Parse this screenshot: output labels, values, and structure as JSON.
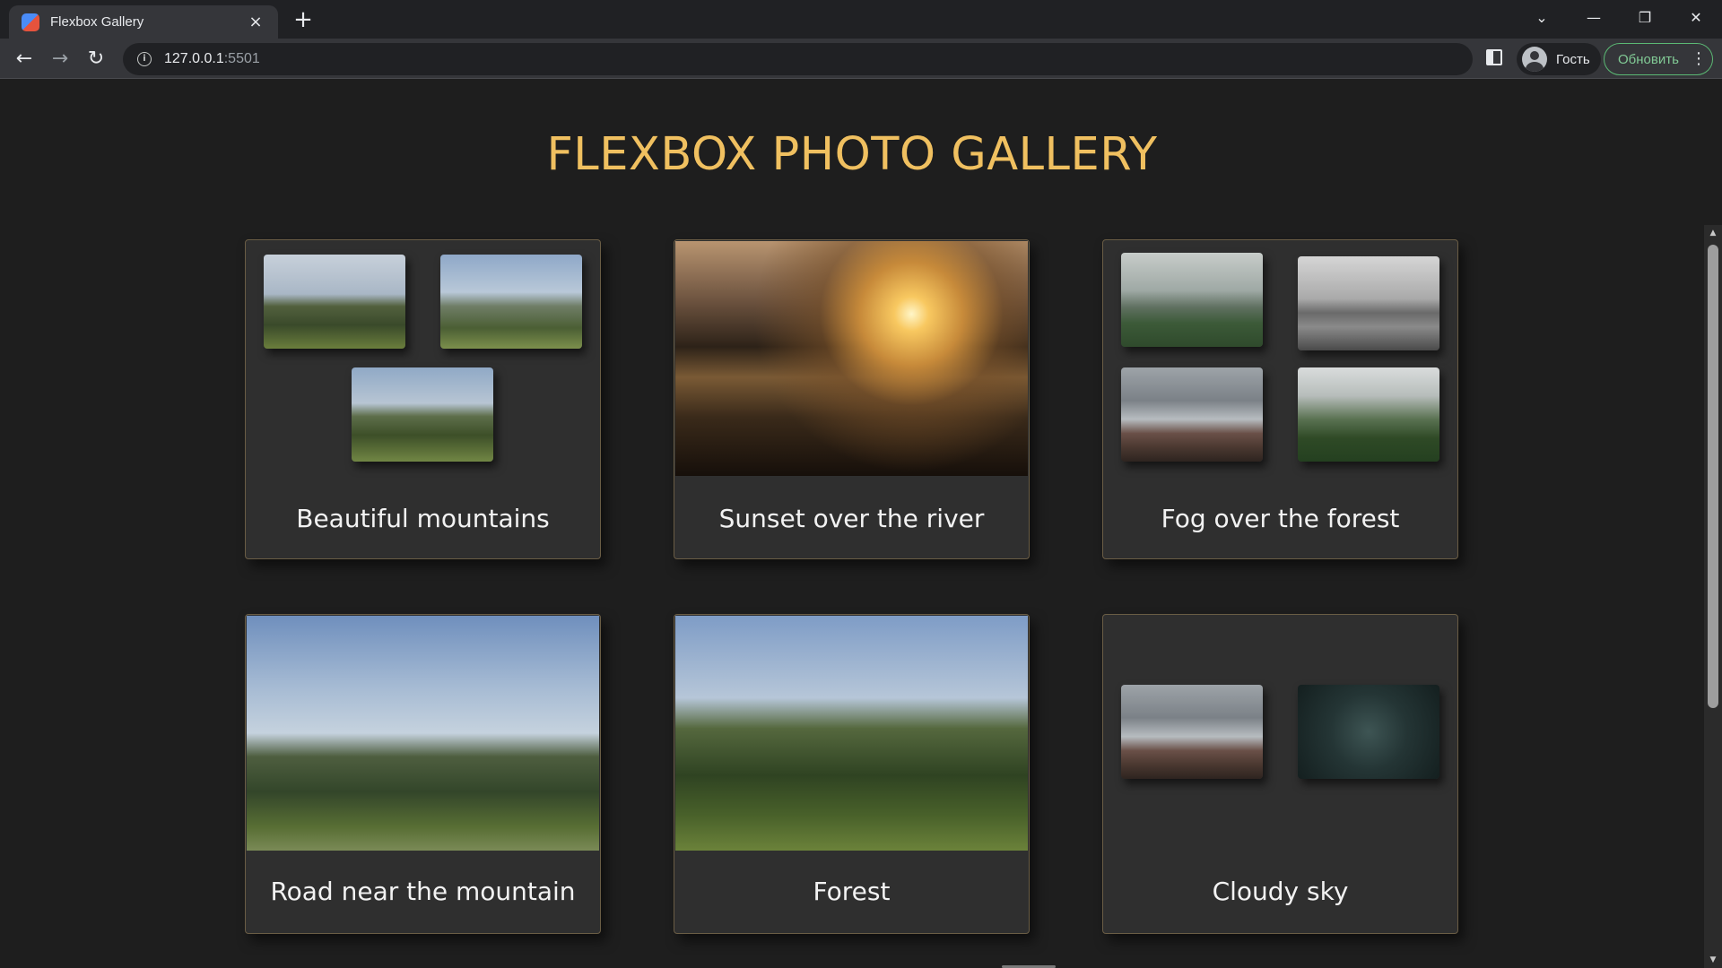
{
  "browser": {
    "tab_title": "Flexbox Gallery",
    "url_host": "127.0.0.1",
    "url_port": ":5501",
    "profile_label": "Гость",
    "update_label": "Обновить",
    "icons": {
      "tab_close": "×",
      "new_tab": "+",
      "tab_search": "⌄",
      "minimize": "—",
      "restore": "❐",
      "close": "✕",
      "back": "←",
      "forward": "→",
      "reload": "↻",
      "info": "i",
      "menu": "⋮"
    }
  },
  "page": {
    "title": "FLEXBOX PHOTO GALLERY",
    "title_color": "#f0c060",
    "cards": [
      {
        "caption": "Beautiful mountains"
      },
      {
        "caption": "Sunset over the river"
      },
      {
        "caption": "Fog over the forest"
      },
      {
        "caption": "Road near the mountain"
      },
      {
        "caption": "Forest"
      },
      {
        "caption": "Cloudy sky"
      }
    ]
  },
  "scrollbar": {
    "up": "▲",
    "down": "▼"
  }
}
